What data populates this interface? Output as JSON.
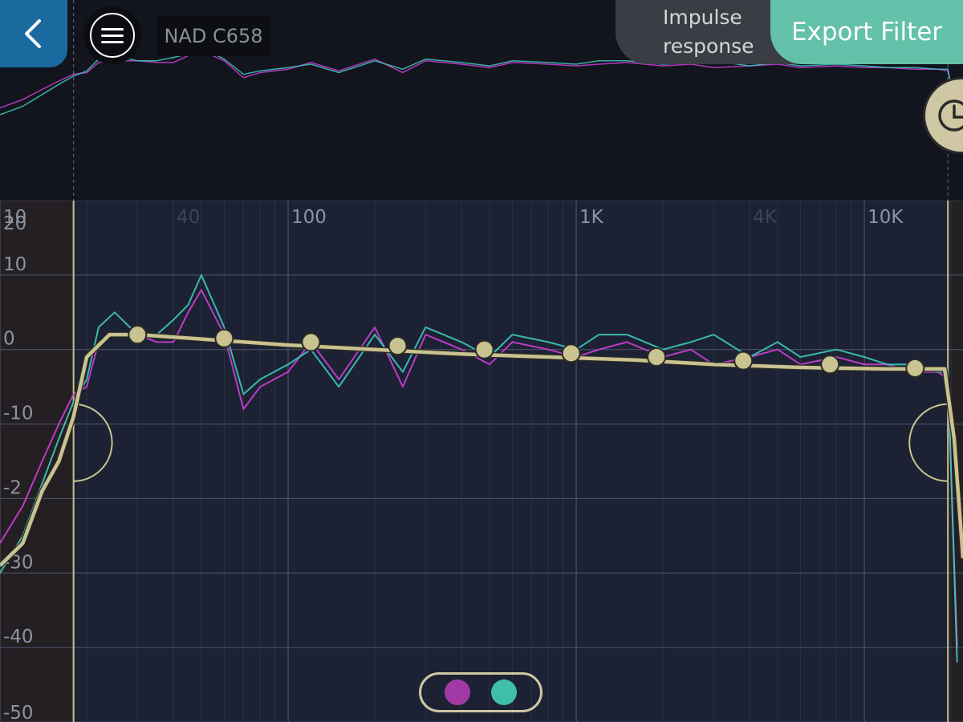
{
  "header": {
    "back_icon": "chevron-left-icon",
    "menu_icon": "hamburger-menu-icon",
    "device_name": "NAD C658",
    "impulse_line1": "Impulse",
    "impulse_line2": "response",
    "export_label": "Export Filter",
    "history_icon": "clock-icon"
  },
  "colors": {
    "magenta": "#cc3fd6",
    "teal": "#3dc9bb",
    "target": "#c9c291",
    "back_button": "#1a6aa0",
    "export_button": "#62c1a8",
    "impulse_button": "#3a3d44"
  },
  "legend": {
    "items": [
      {
        "color": "#a23aa5"
      },
      {
        "color": "#3fbfaa"
      }
    ]
  },
  "chart_data": {
    "type": "line",
    "x_scale": "log",
    "xlim": [
      10,
      22000
    ],
    "ylim": [
      -50,
      20
    ],
    "x_ticks": [
      {
        "value": 10,
        "label": "10"
      },
      {
        "value": 40,
        "label": "40"
      },
      {
        "value": 100,
        "label": "100"
      },
      {
        "value": 1000,
        "label": "1K"
      },
      {
        "value": 4000,
        "label": "4K"
      },
      {
        "value": 10000,
        "label": "10K"
      }
    ],
    "y_ticks": [
      {
        "value": 20,
        "label": "20"
      },
      {
        "value": 10,
        "label": "10"
      },
      {
        "value": 0,
        "label": "0"
      },
      {
        "value": -10,
        "label": "-10"
      },
      {
        "value": -20,
        "label": "-2"
      },
      {
        "value": -30,
        "label": "-30"
      },
      {
        "value": -40,
        "label": "-40"
      },
      {
        "value": -50,
        "label": "-50"
      }
    ],
    "filter_range_hz": [
      18,
      19500
    ],
    "target": {
      "x": [
        10,
        12,
        14,
        16,
        18,
        20,
        24,
        30,
        60,
        100,
        200,
        400,
        800,
        1600,
        3000,
        6000,
        12000,
        19000,
        20500,
        22000
      ],
      "y": [
        -29,
        -26,
        -19,
        -15,
        -9,
        -1,
        2,
        2,
        1.2,
        0.6,
        0,
        -0.6,
        -1,
        -1.4,
        -2,
        -2.4,
        -2.6,
        -2.6,
        -12,
        -28
      ]
    },
    "control_points": {
      "x": [
        30,
        60,
        120,
        240,
        480,
        960,
        1900,
        3800,
        7600,
        15000
      ],
      "y": [
        2,
        1.5,
        1,
        0.5,
        0,
        -0.5,
        -1,
        -1.5,
        -2,
        -2.5
      ]
    },
    "series": [
      {
        "name": "",
        "color": "#cc3fd6",
        "x": [
          10,
          12,
          14,
          16,
          18,
          20,
          22,
          25,
          30,
          35,
          40,
          45,
          50,
          60,
          70,
          80,
          100,
          120,
          150,
          200,
          250,
          300,
          400,
          500,
          600,
          800,
          1000,
          1200,
          1500,
          2000,
          2500,
          3000,
          4000,
          5000,
          6000,
          8000,
          10000,
          12000,
          15000,
          18000,
          19500,
          21000
        ],
        "y": [
          -26,
          -21,
          -15,
          -10,
          -6,
          -5,
          1,
          2,
          2,
          1,
          1,
          5,
          8,
          2,
          -8,
          -5,
          -3,
          1,
          -4,
          3,
          -5,
          2,
          0,
          -2,
          1,
          0,
          -1,
          0,
          1,
          -1,
          0,
          -2,
          -1,
          0,
          -2,
          -1,
          -2,
          -2,
          -3,
          -3,
          -4,
          -40
        ]
      },
      {
        "name": "",
        "color": "#3dc9bb",
        "x": [
          10,
          12,
          14,
          16,
          18,
          20,
          22,
          25,
          30,
          35,
          40,
          45,
          50,
          60,
          70,
          80,
          100,
          120,
          150,
          200,
          250,
          300,
          400,
          500,
          600,
          800,
          1000,
          1200,
          1500,
          2000,
          2500,
          3000,
          4000,
          5000,
          6000,
          8000,
          10000,
          12000,
          15000,
          18000,
          19500,
          21000
        ],
        "y": [
          -30,
          -25,
          -18,
          -12,
          -7,
          -4,
          3,
          5,
          2,
          2,
          4,
          6,
          10,
          3,
          -6,
          -4,
          -2,
          0,
          -5,
          2,
          -3,
          3,
          1,
          -1,
          2,
          1,
          0,
          2,
          2,
          0,
          1,
          2,
          -1,
          1,
          -1,
          0,
          -1,
          -2,
          -2,
          -3,
          -3,
          -42
        ]
      }
    ]
  }
}
